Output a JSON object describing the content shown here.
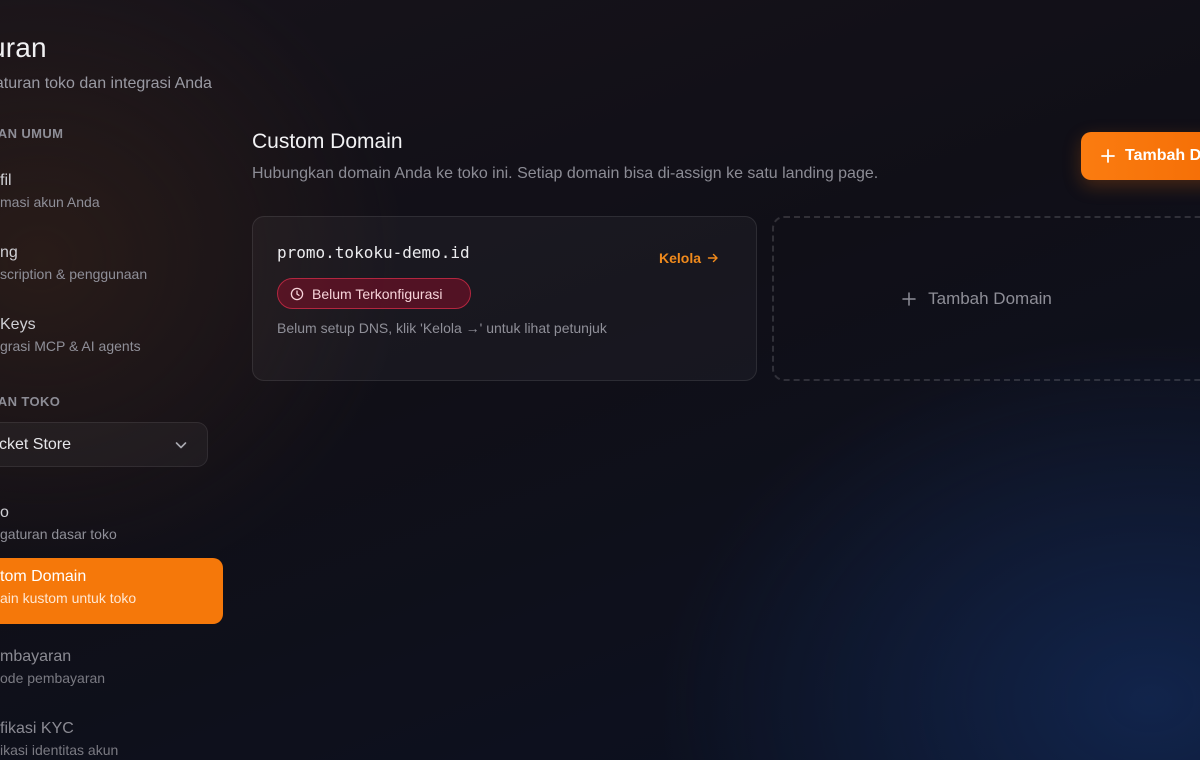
{
  "page": {
    "title": "turan",
    "subtitle": "gaturan toko dan integrasi Anda"
  },
  "sidebar": {
    "general_heading": "RAN UMUM",
    "general_items": [
      {
        "label": "fil",
        "desc": "masi akun Anda"
      },
      {
        "label": "ng",
        "desc": "scription & penggunaan"
      },
      {
        "label": "Keys",
        "desc": "grasi MCP & AI agents"
      }
    ],
    "store_heading": "RAN TOKO",
    "store_select": {
      "value": "cket Store",
      "icon": "chevron-down-icon"
    },
    "store_items": [
      {
        "label": "o",
        "desc": "gaturan dasar toko",
        "active": false
      },
      {
        "label": "tom Domain",
        "desc": "ain kustom untuk toko",
        "active": true
      },
      {
        "label": "mbayaran",
        "desc": "ode pembayaran",
        "active": false
      },
      {
        "label": "fikasi KYC",
        "desc": "ikasi identitas akun",
        "active": false
      }
    ]
  },
  "main": {
    "title": "Custom Domain",
    "description": "Hubungkan domain Anda ke toko ini. Setiap domain bisa di-assign ke satu landing page.",
    "add_button_label": "Tambah D",
    "domains": [
      {
        "name": "promo.tokoku-demo.id",
        "manage_label": "Kelola",
        "status_label": "Belum Terkonfigurasi",
        "hint": "Belum setup DNS, klik 'Kelola →' untuk lihat petunjuk"
      }
    ],
    "add_card_label": "Tambah Domain"
  },
  "colors": {
    "accent": "#f5780a",
    "status_error_border": "#b3263f",
    "link": "#f08a1c"
  }
}
